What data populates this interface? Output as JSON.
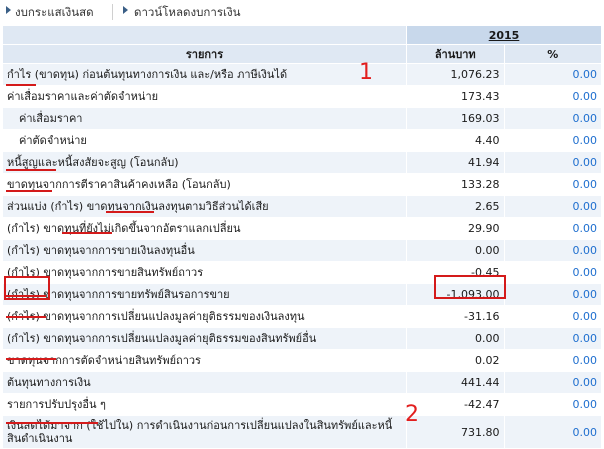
{
  "nav": {
    "cashflow_label": "งบกระแสเงินสด",
    "download_label": "ดาวน์โหลดงบการเงิน"
  },
  "table": {
    "year": "2015",
    "col_item": "รายการ",
    "col_amount": "ล้านบาท",
    "col_pct": "%",
    "rows": [
      {
        "label": "กำไร (ขาดทุน) ก่อนต้นทุนทางการเงิน และ/หรือ ภาษีเงินได้",
        "value": "1,076.23",
        "pct": "0.00"
      },
      {
        "label": "ค่าเสื่อมราคาและค่าตัดจำหน่าย",
        "value": "173.43",
        "pct": "0.00"
      },
      {
        "label": "ค่าเสื่อมราคา",
        "value": "169.03",
        "pct": "0.00"
      },
      {
        "label": "ค่าตัดจำหน่าย",
        "value": "4.40",
        "pct": "0.00"
      },
      {
        "label": "หนี้สูญและหนี้สงสัยจะสูญ (โอนกลับ)",
        "value": "41.94",
        "pct": "0.00"
      },
      {
        "label": "ขาดทุนจากการตีราคาสินค้าคงเหลือ (โอนกลับ)",
        "value": "133.28",
        "pct": "0.00"
      },
      {
        "label": "ส่วนแบ่ง (กำไร) ขาดทุนจากเงินลงทุนตามวิธีส่วนได้เสีย",
        "value": "2.65",
        "pct": "0.00"
      },
      {
        "label": "(กำไร) ขาดทุนที่ยังไม่เกิดขึ้นจากอัตราแลกเปลี่ยน",
        "value": "29.90",
        "pct": "0.00"
      },
      {
        "label": "(กำไร) ขาดทุนจากการขายเงินลงทุนอื่น",
        "value": "0.00",
        "pct": "0.00"
      },
      {
        "label": "(กำไร) ขาดทุนจากการขายสินทรัพย์ถาวร",
        "value": "-0.45",
        "pct": "0.00"
      },
      {
        "label": "(กำไร) ขาดทุนจากการขายทรัพย์สินรอการขาย",
        "value": "-1,093.00",
        "pct": "0.00"
      },
      {
        "label": "(กำไร) ขาดทุนจากการเปลี่ยนแปลงมูลค่ายุติธรรมของเงินลงทุน",
        "value": "-31.16",
        "pct": "0.00"
      },
      {
        "label": "(กำไร) ขาดทุนจากการเปลี่ยนแปลงมูลค่ายุติธรรมของสินทรัพย์อื่น",
        "value": "0.00",
        "pct": "0.00"
      },
      {
        "label": "ขาดทุนจากการตัดจำหน่ายสินทรัพย์ถาวร",
        "value": "0.02",
        "pct": "0.00"
      },
      {
        "label": "ต้นทุนทางการเงิน",
        "value": "441.44",
        "pct": "0.00"
      },
      {
        "label": "รายการปรับปรุงอื่น ๆ",
        "value": "-42.47",
        "pct": "0.00"
      },
      {
        "label": "เงินสดได้มาจาก (ใช้ไปใน) การดำเนินงานก่อนการเปลี่ยนแปลงในสินทรัพย์และหนี้สินดำเนินงาน",
        "value": "731.80",
        "pct": "0.00"
      }
    ]
  },
  "annotations": {
    "marker_1": "1",
    "marker_2": "2",
    "color": "#d41a1a"
  }
}
